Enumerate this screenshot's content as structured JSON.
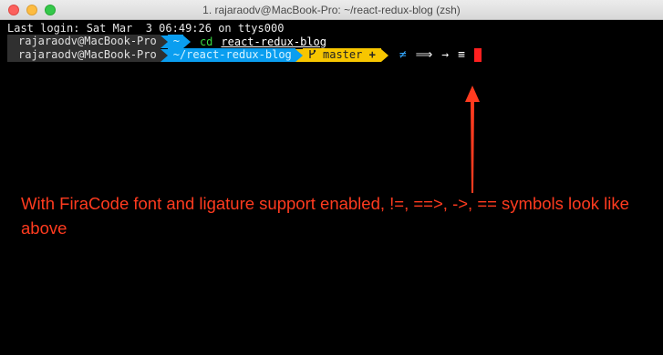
{
  "window": {
    "title": "1. rajaraodv@MacBook-Pro: ~/react-redux-blog (zsh)"
  },
  "terminal": {
    "last_login": "Last login: Sat Mar  3 06:49:26 on ttys000",
    "line1": {
      "user": "rajaraodv@MacBook-Pro",
      "dir": "~",
      "cmd": "cd",
      "arg": "react-redux-blog"
    },
    "line2": {
      "user": "rajaraodv@MacBook-Pro",
      "dir": "~/react-redux-blog",
      "git_branch": "master",
      "git_status": "+",
      "ligatures": [
        "≠",
        "⟹",
        "→",
        "≡"
      ]
    }
  },
  "annotation": {
    "text": "With FiraCode font and ligature support enabled, !=, ==>, ->, == symbols look like above",
    "color": "#ff3b1f"
  },
  "colors": {
    "segment_user": "#303030",
    "segment_dir": "#0a9ef0",
    "segment_git": "#f7c600",
    "cursor": "#ff2020"
  }
}
